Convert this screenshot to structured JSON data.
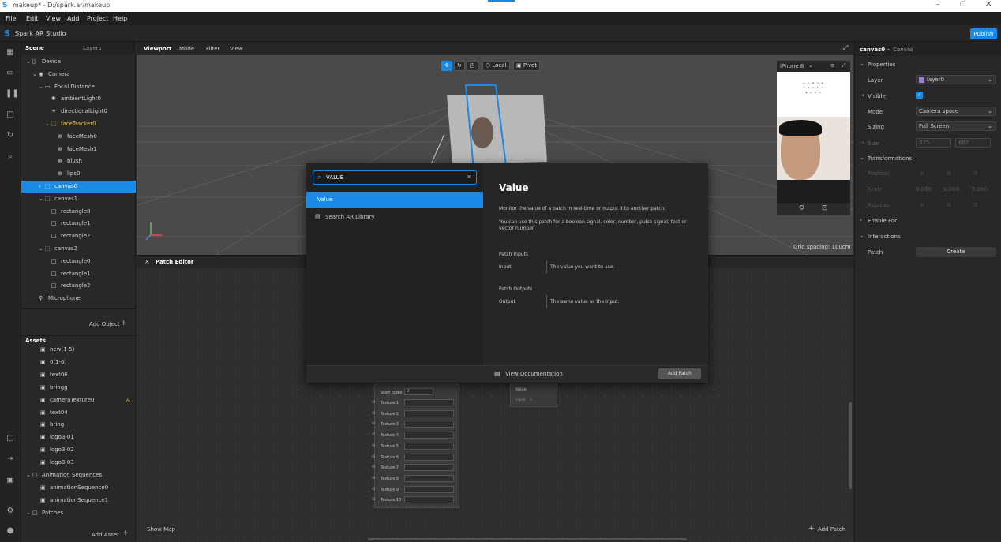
{
  "window": {
    "title": "makeup* - D:/spark.ar/makeup"
  },
  "menu": [
    "File",
    "Edit",
    "View",
    "Add",
    "Project",
    "Help"
  ],
  "app": {
    "name": "Spark AR Studio",
    "publish_label": "Publish"
  },
  "scene": {
    "tabs": [
      "Scene",
      "Layers"
    ],
    "tree": [
      {
        "label": "Device",
        "indent": 0
      },
      {
        "label": "Camera",
        "indent": 1
      },
      {
        "label": "Focal Distance",
        "indent": 2
      },
      {
        "label": "ambientLight0",
        "indent": 3
      },
      {
        "label": "directionalLight0",
        "indent": 3
      },
      {
        "label": "faceTracker0",
        "indent": 3
      },
      {
        "label": "faceMesh0",
        "indent": 4
      },
      {
        "label": "faceMesh1",
        "indent": 4
      },
      {
        "label": "blush",
        "indent": 4
      },
      {
        "label": "lips0",
        "indent": 4
      },
      {
        "label": "canvas0",
        "indent": 2
      },
      {
        "label": "canvas1",
        "indent": 2
      },
      {
        "label": "rectangle0",
        "indent": 3
      },
      {
        "label": "rectangle1",
        "indent": 3
      },
      {
        "label": "rectangle2",
        "indent": 3
      },
      {
        "label": "canvas2",
        "indent": 2
      },
      {
        "label": "rectangle0",
        "indent": 3
      },
      {
        "label": "rectangle1",
        "indent": 3
      },
      {
        "label": "rectangle2",
        "indent": 3
      },
      {
        "label": "Microphone",
        "indent": 1
      }
    ],
    "add_object_label": "Add Object"
  },
  "assets": {
    "header": "Assets",
    "items": [
      {
        "label": "new(1-5)"
      },
      {
        "label": "0(1-6)"
      },
      {
        "label": "text06"
      },
      {
        "label": "bringg"
      },
      {
        "label": "cameraTexture0",
        "badge": "A"
      },
      {
        "label": "text04"
      },
      {
        "label": "bring"
      },
      {
        "label": "logo3-01"
      },
      {
        "label": "logo3-02"
      },
      {
        "label": "logo3-03"
      },
      {
        "label": "Animation Sequences",
        "folder": true
      },
      {
        "label": "animationSequence0"
      },
      {
        "label": "animationSequence1"
      },
      {
        "label": "Patches",
        "folder": true
      }
    ],
    "add_asset_label": "Add Asset"
  },
  "viewport": {
    "tabs": [
      "Viewport",
      "Mode",
      "Filter",
      "View"
    ],
    "local_label": "Local",
    "pivot_label": "Pivot",
    "device_label": "iPhone 8",
    "grid_spacing": "Grid spacing: 100cm"
  },
  "patch_editor": {
    "title": "Patch Editor",
    "show_map": "Show Map",
    "add_patch": "Add Patch",
    "start_index_label": "Start Index",
    "start_index_value": "0",
    "textures": [
      "Texture 1",
      "Texture 2",
      "Texture 3",
      "Texture 4",
      "Texture 5",
      "Texture 6",
      "Texture 7",
      "Texture 8",
      "Texture 9",
      "Texture 10"
    ],
    "value_node": {
      "title": "Value",
      "input_label": "Input",
      "input_value": "0"
    }
  },
  "popup": {
    "search_value": "VALUE",
    "results": [
      "Value",
      "Search AR Library"
    ],
    "title": "Value",
    "desc1": "Monitor the value of a patch in real-time or output it to another patch.",
    "desc2": "You can use this patch for a boolean signal, color, number, pulse signal, text or vector number.",
    "inputs_header": "Patch Inputs",
    "input_name": "Input",
    "input_desc": "The value you want to use.",
    "outputs_header": "Patch Outputs",
    "output_name": "Output",
    "output_desc": "The same value as the input.",
    "view_docs": "View Documentation",
    "add_patch": "Add Patch"
  },
  "inspector": {
    "object": "canvas0",
    "type": "~ Canvas",
    "properties_header": "Properties",
    "layer_label": "Layer",
    "layer_value": "layer0",
    "layer_color": "#9b7fd4",
    "visible_label": "Visible",
    "mode_label": "Mode",
    "mode_value": "Camera space",
    "sizing_label": "Sizing",
    "sizing_value": "Full Screen",
    "size_label": "Size",
    "size_w": "375",
    "size_h": "667",
    "transformations_header": "Transformations",
    "position_label": "Position",
    "scale_label": "Scale",
    "rotation_label": "Rotation",
    "zero": "0",
    "one": "0.000",
    "enable_for": "Enable For",
    "interactions_header": "Interactions",
    "patch_label": "Patch",
    "create_label": "Create",
    "accent_color": "#1a8ae6",
    "highlight_color": "#f0c040"
  }
}
